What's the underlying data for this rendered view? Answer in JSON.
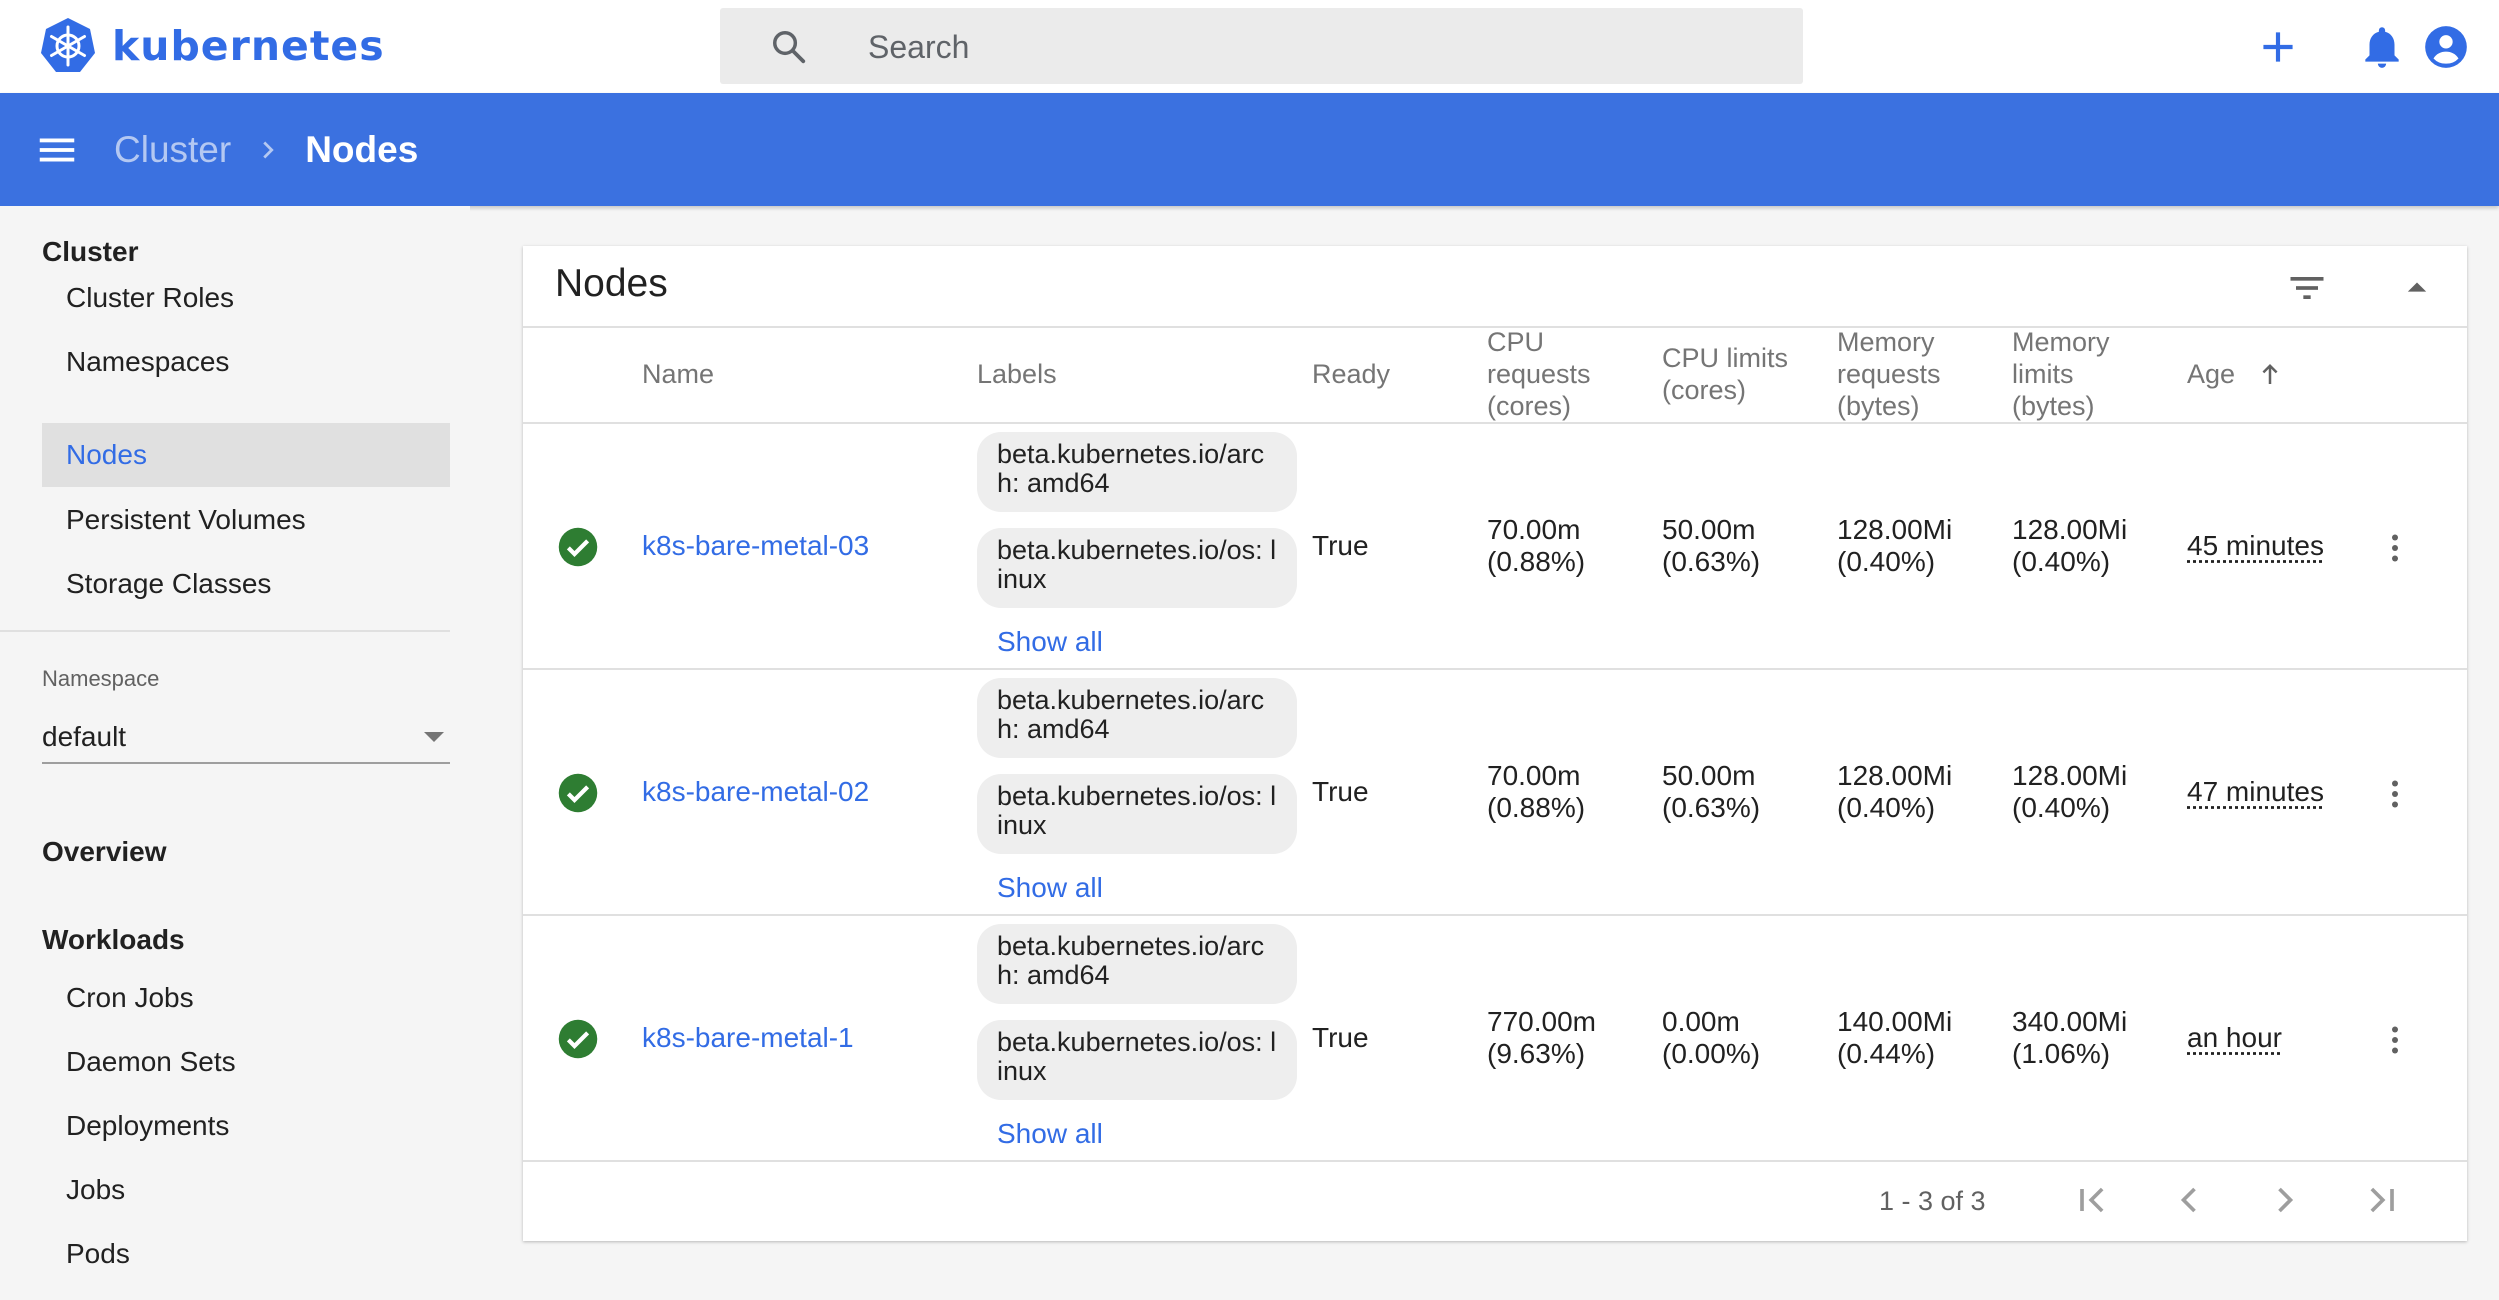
{
  "app": {
    "name": "kubernetes"
  },
  "search": {
    "placeholder": "Search"
  },
  "header": {
    "breadcrumb_parent": "Cluster",
    "breadcrumb_current": "Nodes"
  },
  "sidebar": {
    "cluster_heading": "Cluster",
    "cluster_items": [
      {
        "label": "Cluster Roles"
      },
      {
        "label": "Namespaces"
      },
      {
        "label": "Nodes",
        "active": true
      },
      {
        "label": "Persistent Volumes"
      },
      {
        "label": "Storage Classes"
      }
    ],
    "namespace_label": "Namespace",
    "namespace_value": "default",
    "overview_heading": "Overview",
    "workloads_heading": "Workloads",
    "workload_items": [
      {
        "label": "Cron Jobs"
      },
      {
        "label": "Daemon Sets"
      },
      {
        "label": "Deployments"
      },
      {
        "label": "Jobs"
      },
      {
        "label": "Pods"
      }
    ]
  },
  "card": {
    "title": "Nodes",
    "columns": {
      "name": "Name",
      "labels": "Labels",
      "ready": "Ready",
      "cpu_requests": "CPU requests (cores)",
      "cpu_limits": "CPU limits (cores)",
      "mem_requests": "Memory requests (bytes)",
      "mem_limits": "Memory limits (bytes)",
      "age": "Age"
    },
    "rows": [
      {
        "name": "k8s-bare-metal-03",
        "label_1": "beta.kubernetes.io/arch: amd64",
        "label_2": "beta.kubernetes.io/os: linux",
        "show_all": "Show all",
        "ready": "True",
        "cpu_req_value": "70.00m",
        "cpu_req_pct": "(0.88%)",
        "cpu_lim_value": "50.00m",
        "cpu_lim_pct": "(0.63%)",
        "mem_req_value": "128.00Mi",
        "mem_req_pct": "(0.40%)",
        "mem_lim_value": "128.00Mi",
        "mem_lim_pct": "(0.40%)",
        "age": "45 minutes"
      },
      {
        "name": "k8s-bare-metal-02",
        "label_1": "beta.kubernetes.io/arch: amd64",
        "label_2": "beta.kubernetes.io/os: linux",
        "show_all": "Show all",
        "ready": "True",
        "cpu_req_value": "70.00m",
        "cpu_req_pct": "(0.88%)",
        "cpu_lim_value": "50.00m",
        "cpu_lim_pct": "(0.63%)",
        "mem_req_value": "128.00Mi",
        "mem_req_pct": "(0.40%)",
        "mem_lim_value": "128.00Mi",
        "mem_lim_pct": "(0.40%)",
        "age": "47 minutes"
      },
      {
        "name": "k8s-bare-metal-1",
        "label_1": "beta.kubernetes.io/arch: amd64",
        "label_2": "beta.kubernetes.io/os: linux",
        "show_all": "Show all",
        "ready": "True",
        "cpu_req_value": "770.00m",
        "cpu_req_pct": "(9.63%)",
        "cpu_lim_value": "0.00m",
        "cpu_lim_pct": "(0.00%)",
        "mem_req_value": "140.00Mi",
        "mem_req_pct": "(0.44%)",
        "mem_lim_value": "340.00Mi",
        "mem_lim_pct": "(1.06%)",
        "age": "an hour"
      }
    ],
    "pagination": {
      "range": "1 - 3 of 3"
    }
  },
  "colors": {
    "brand": "#326ce5",
    "header_bg": "#3b71e0",
    "ready_green": "#2e7d32"
  },
  "icons": {
    "top": [
      "add-icon",
      "notifications-icon",
      "account-circle-icon"
    ],
    "card": [
      "filter-icon",
      "collapse-icon"
    ],
    "row_status": "check-circle-icon",
    "row_menu": "more-vert-icon",
    "pager": [
      "first-page-icon",
      "previous-page-icon",
      "next-page-icon",
      "last-page-icon"
    ]
  }
}
